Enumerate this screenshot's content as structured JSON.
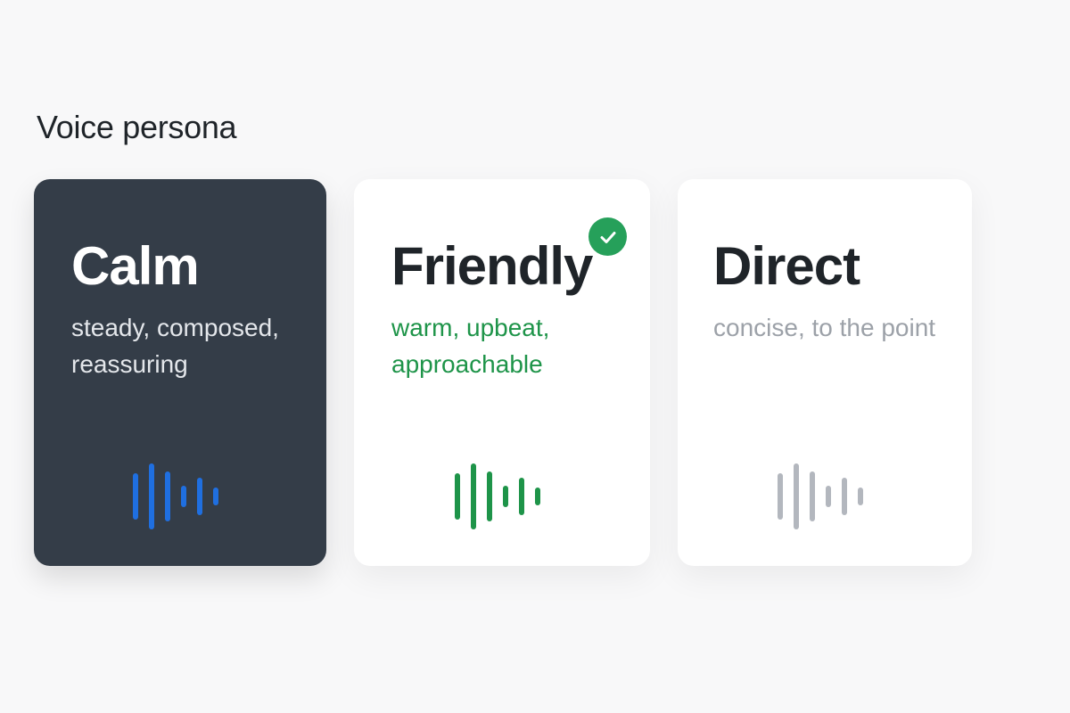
{
  "section": {
    "title": "Voice persona"
  },
  "personas": [
    {
      "name": "Calm",
      "description": "steady, composed, reassuring",
      "wave_color": "#1f6fe0",
      "selected": false
    },
    {
      "name": "Friendly",
      "description": "warm, upbeat, approachable",
      "wave_color": "#1e9449",
      "selected": true,
      "badge_icon": "check-icon",
      "badge_color": "#26a05a"
    },
    {
      "name": "Direct",
      "description": "concise, to the point",
      "wave_color": "#b3b7be",
      "selected": false
    }
  ],
  "icons": {
    "waveform": "sound-waveform-icon"
  }
}
